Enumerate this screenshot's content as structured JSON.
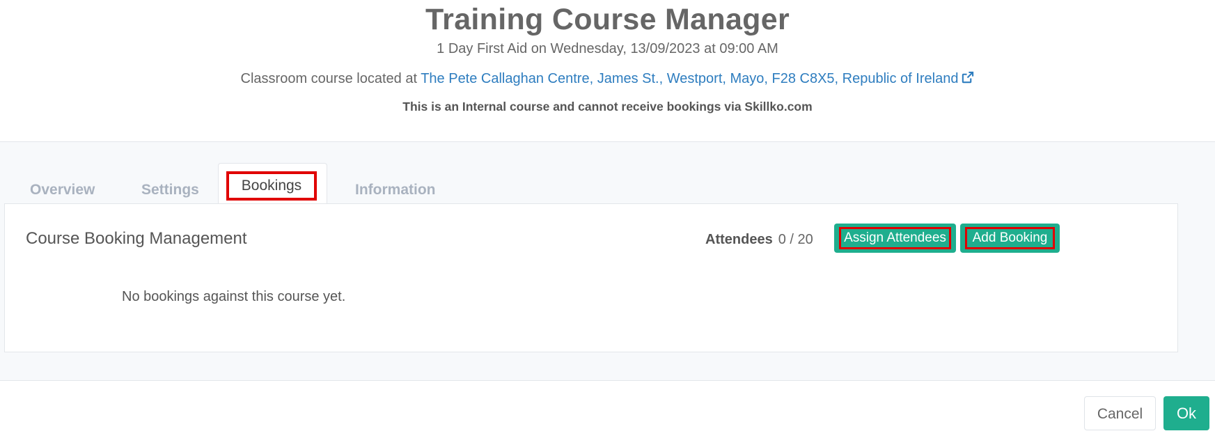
{
  "header": {
    "title": "Training Course Manager",
    "subtitle": "1 Day First Aid on Wednesday, 13/09/2023 at 09:00 AM",
    "location_prefix": "Classroom course located at ",
    "location_link": "The Pete Callaghan Centre, James St., Westport, Mayo, F28 C8X5, Republic of Ireland",
    "location_icon": "external-link-icon",
    "internal_note": "This is an Internal course and cannot receive bookings via Skillko.com"
  },
  "tabs": [
    {
      "label": "Overview",
      "active": false
    },
    {
      "label": "Settings",
      "active": false
    },
    {
      "label": "Bookings",
      "active": true
    },
    {
      "label": "Information",
      "active": false
    }
  ],
  "panel": {
    "title": "Course Booking Management",
    "attendees_label": "Attendees",
    "attendees_count": "0 / 20",
    "assign_button": "Assign Attendees",
    "add_button": "Add Booking",
    "empty_message": "No bookings against this course yet."
  },
  "footer": {
    "cancel_label": "Cancel",
    "ok_label": "Ok"
  },
  "colors": {
    "accent_green": "#1fae8e",
    "link_blue": "#2e7dbf",
    "highlight_red": "#e00000"
  }
}
